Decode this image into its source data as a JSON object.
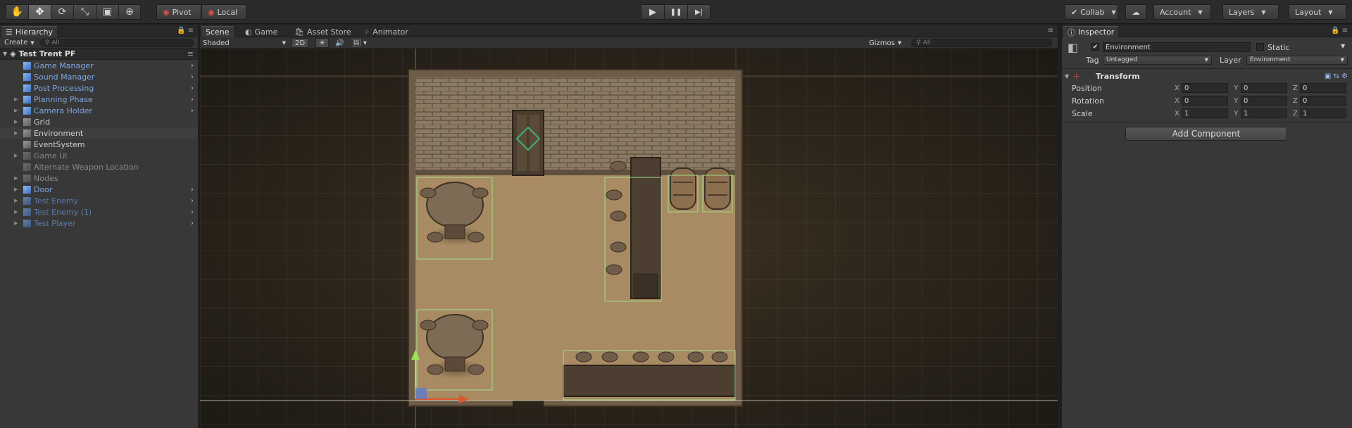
{
  "toolbar": {
    "transform_tools": [
      {
        "icon": "hand-icon",
        "glyph": "✋"
      },
      {
        "icon": "move-icon",
        "glyph": "✥"
      },
      {
        "icon": "rotate-icon",
        "glyph": "⟳"
      },
      {
        "icon": "scale-icon",
        "glyph": "⤡"
      },
      {
        "icon": "rect-icon",
        "glyph": "▣"
      },
      {
        "icon": "transform-icon",
        "glyph": "⊕"
      }
    ],
    "pivot_label": "Pivot",
    "local_label": "Local",
    "play_glyph": "▶",
    "pause_glyph": "❚❚",
    "step_glyph": "▶|",
    "collab_label": "Collab",
    "cloud_glyph": "☁",
    "account_label": "Account",
    "layers_label": "Layers",
    "layout_label": "Layout"
  },
  "hierarchy": {
    "tab_label": "Hierarchy",
    "create_label": "Create",
    "search_placeholder": "All",
    "scene_name": "Test Trent PF",
    "items": [
      {
        "label": "Game Manager",
        "style": "prefab",
        "has_children": false,
        "expand": true
      },
      {
        "label": "Sound Manager",
        "style": "prefab",
        "has_children": false,
        "expand": true
      },
      {
        "label": "Post Processing",
        "style": "prefab",
        "has_children": false,
        "expand": true
      },
      {
        "label": "Planning Phase",
        "style": "prefab",
        "has_children": true,
        "expand": true
      },
      {
        "label": "Camera Holder",
        "style": "prefab",
        "has_children": true,
        "expand": true
      },
      {
        "label": "Grid",
        "style": "normal",
        "has_children": true,
        "expand": false
      },
      {
        "label": "Environment",
        "style": "normal",
        "has_children": true,
        "expand": false,
        "selected": true
      },
      {
        "label": "EventSystem",
        "style": "normal",
        "has_children": false,
        "expand": false
      },
      {
        "label": "Game UI",
        "style": "dim",
        "has_children": true,
        "expand": false
      },
      {
        "label": "Alternate Weapon Location",
        "style": "dim",
        "has_children": false,
        "expand": false
      },
      {
        "label": "Nodes",
        "style": "dim",
        "has_children": true,
        "expand": false
      },
      {
        "label": "Door",
        "style": "prefab",
        "has_children": true,
        "expand": true
      },
      {
        "label": "Test Enemy",
        "style": "prefab-dim",
        "has_children": true,
        "expand": true
      },
      {
        "label": "Test Enemy (1)",
        "style": "prefab-dim",
        "has_children": true,
        "expand": true
      },
      {
        "label": "Test Player",
        "style": "prefab-dim",
        "has_children": true,
        "expand": true
      }
    ]
  },
  "scene_tabs": {
    "scene": "Scene",
    "game": "Game",
    "asset_store": "Asset Store",
    "animator": "Animator"
  },
  "scene_toolbar": {
    "shading_mode": "Shaded",
    "mode_2d": "2D",
    "gizmos_label": "Gizmos",
    "search_placeholder": "All"
  },
  "inspector": {
    "tab_label": "Inspector",
    "object_name": "Environment",
    "active_checked": true,
    "static_label": "Static",
    "tag_label": "Tag",
    "tag_value": "Untagged",
    "layer_label": "Layer",
    "layer_value": "Environment",
    "component_title": "Transform",
    "transform": [
      {
        "label": "Position",
        "x": "0",
        "y": "0",
        "z": "0"
      },
      {
        "label": "Rotation",
        "x": "0",
        "y": "0",
        "z": "0"
      },
      {
        "label": "Scale",
        "x": "1",
        "y": "1",
        "z": "1"
      }
    ],
    "axis_x": "X",
    "axis_y": "Y",
    "axis_z": "Z",
    "add_component_label": "Add Component"
  },
  "colors": {
    "accent_blue": "#7ea8e6",
    "selection_green": "#9fe08a",
    "floor": "#a88a63",
    "wall": "#7a6a55"
  }
}
